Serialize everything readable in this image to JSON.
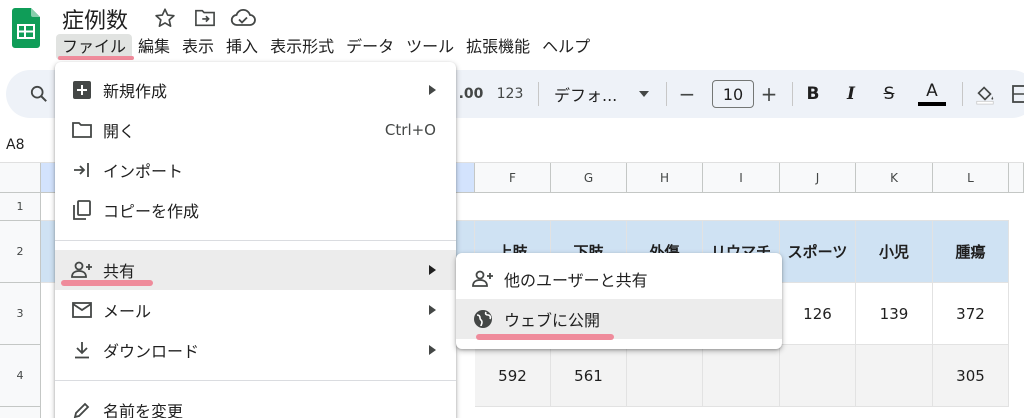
{
  "doc": {
    "title": "症例数"
  },
  "menubar": [
    "ファイル",
    "編集",
    "表示",
    "挿入",
    "表示形式",
    "データ",
    "ツール",
    "拡張機能",
    "ヘルプ"
  ],
  "toolbar": {
    "decimal": ".00",
    "number_format": "123",
    "font_name": "デフォ...",
    "font_size": "10",
    "minus": "−",
    "plus": "+",
    "bold": "B",
    "italic": "I",
    "strike": "S",
    "text_color": "A"
  },
  "name_box": "A8",
  "columns": [
    "F",
    "G",
    "H",
    "I",
    "J",
    "K",
    "L"
  ],
  "rows": [
    "1",
    "2",
    "3",
    "4"
  ],
  "grid": {
    "row2": [
      "上肢",
      "下肢",
      "外傷",
      "リウマチ",
      "スポーツ",
      "小児",
      "腫瘍"
    ],
    "row3": [
      "",
      "",
      "",
      "",
      "126",
      "139",
      "372"
    ],
    "row4": [
      "592",
      "561",
      "",
      "",
      "",
      "",
      "305"
    ]
  },
  "file_menu": {
    "items": [
      {
        "label": "新規作成",
        "icon": "plus-box-icon",
        "shortcut": "",
        "submenu": true
      },
      {
        "label": "開く",
        "icon": "folder-icon",
        "shortcut": "Ctrl+O",
        "submenu": false
      },
      {
        "label": "インポート",
        "icon": "import-icon",
        "shortcut": "",
        "submenu": false
      },
      {
        "label": "コピーを作成",
        "icon": "copy-icon",
        "shortcut": "",
        "submenu": false
      },
      {
        "label": "共有",
        "icon": "person-add-icon",
        "shortcut": "",
        "submenu": true
      },
      {
        "label": "メール",
        "icon": "mail-icon",
        "shortcut": "",
        "submenu": true
      },
      {
        "label": "ダウンロード",
        "icon": "download-icon",
        "shortcut": "",
        "submenu": true
      },
      {
        "label": "名前を変更",
        "icon": "pencil-icon",
        "shortcut": "",
        "submenu": false
      }
    ]
  },
  "share_submenu": {
    "items": [
      {
        "label": "他のユーザーと共有",
        "icon": "person-add-icon"
      },
      {
        "label": "ウェブに公開",
        "icon": "globe-icon"
      }
    ]
  },
  "colors": {
    "header_cell_bg": "#cfe2f3",
    "highlight_pink": "#ef8b9b",
    "sheets_green": "#0f9d58",
    "toolbar_bg": "#eef2f8"
  }
}
